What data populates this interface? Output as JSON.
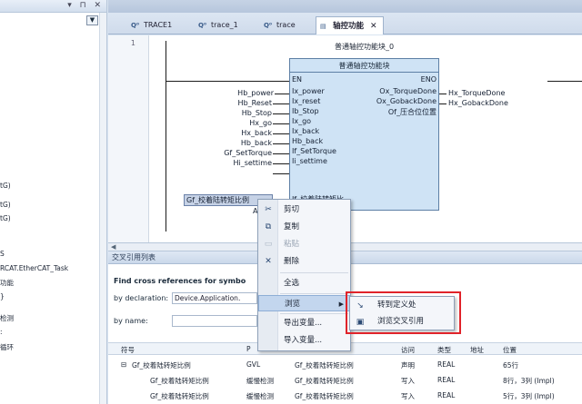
{
  "left_panel": {
    "controls": "▾ ⊓ ✕",
    "items": [
      "tG)",
      "tG)",
      "tG)",
      "S",
      "RCAT.EtherCAT_Task",
      "功能",
      "}",
      "检测",
      ":",
      "循环"
    ]
  },
  "tabs": [
    {
      "label": "TRACE1",
      "icon": "trace-icon"
    },
    {
      "label": "trace_1",
      "icon": "trace-icon"
    },
    {
      "label": "trace",
      "icon": "trace-icon"
    },
    {
      "label": "轴控功能",
      "icon": "document-icon",
      "active": true
    }
  ],
  "editor": {
    "line_number": "1",
    "instance_name": "普通轴控功能块_0",
    "block_title": "普通轴控功能块",
    "en": "EN",
    "eno": "ENO",
    "inputs": [
      {
        "var": "Hb_power",
        "pin": "Ix_power"
      },
      {
        "var": "Hb_Reset",
        "pin": "Ix_reset"
      },
      {
        "var": "Hb_Stop",
        "pin": "Ib_Stop"
      },
      {
        "var": "Hx_go",
        "pin": "Ix_go"
      },
      {
        "var": "Hx_back",
        "pin": "Ix_back"
      },
      {
        "var": "Hb_back",
        "pin": "Hb_back"
      },
      {
        "var": "Gf_SetTorque",
        "pin": "If_SetTorque"
      },
      {
        "var": "Hi_settime",
        "pin": "Ii_settime"
      },
      {
        "var": "Gf_校着陆转矩比例",
        "pin": "If_校着陆转矩比"
      }
    ],
    "extra_var": "A",
    "outputs": [
      {
        "pin": "Ox_TorqueDone",
        "var": "Hx_TorqueDone"
      },
      {
        "pin": "Ox_GobackDone",
        "var": "Hx_GobackDone"
      },
      {
        "pin": "Of_压合位位置",
        "var": ""
      }
    ]
  },
  "xref": {
    "panel_title": "交叉引用列表",
    "find_label": "Find cross references for symbo",
    "by_declaration_label": "by declaration:",
    "by_declaration_value": "Device.Application.",
    "by_name_label": "by name:",
    "columns": [
      "符号",
      "P",
      "",
      "访问",
      "类型",
      "地址",
      "位置"
    ],
    "rows": [
      {
        "expand": "⊟",
        "symbol": "Gf_校着陆转矩比例",
        "scope": "GVL",
        "name": "Gf_校着陆转矩比例",
        "access": "声明",
        "type": "REAL",
        "addr": "",
        "loc": "65行"
      },
      {
        "expand": "",
        "symbol": "Gf_校着陆转矩比例",
        "scope": "缓慢检测",
        "name": "Gf_校着陆转矩比例",
        "access": "写入",
        "type": "REAL",
        "addr": "",
        "loc": "8行，3列 (Impl)"
      },
      {
        "expand": "",
        "symbol": "Gf_校着陆转矩比例",
        "scope": "缓慢检测",
        "name": "Gf_校着陆转矩比例",
        "access": "写入",
        "type": "REAL",
        "addr": "",
        "loc": "5行，3列 (Impl)"
      }
    ]
  },
  "context_menu": {
    "items": [
      {
        "label": "剪切",
        "icon": "scissors-icon",
        "glyph": "✂",
        "disabled": false
      },
      {
        "label": "复制",
        "icon": "copy-icon",
        "glyph": "⧉",
        "disabled": false
      },
      {
        "label": "粘贴",
        "icon": "paste-icon",
        "glyph": "📋",
        "disabled": true
      },
      {
        "label": "删除",
        "icon": "delete-icon",
        "glyph": "✕",
        "disabled": false
      },
      {
        "label": "全选",
        "icon": "",
        "glyph": "",
        "disabled": false
      },
      {
        "label": "浏览",
        "icon": "",
        "glyph": "",
        "disabled": false,
        "submenu": true
      },
      {
        "label": "导出变量...",
        "icon": "",
        "glyph": "",
        "disabled": false
      },
      {
        "label": "导入变量...",
        "icon": "",
        "glyph": "",
        "disabled": false
      }
    ],
    "submenu": [
      {
        "label": "转到定义处",
        "icon": "goto-definition-icon",
        "glyph": "↘"
      },
      {
        "label": "浏览交叉引用",
        "icon": "cross-reference-icon",
        "glyph": "▣"
      }
    ]
  },
  "colors": {
    "highlight_box": "#e0232a",
    "block_fill": "#cfe3f5",
    "menu_highlight": "#c3d6ee"
  }
}
